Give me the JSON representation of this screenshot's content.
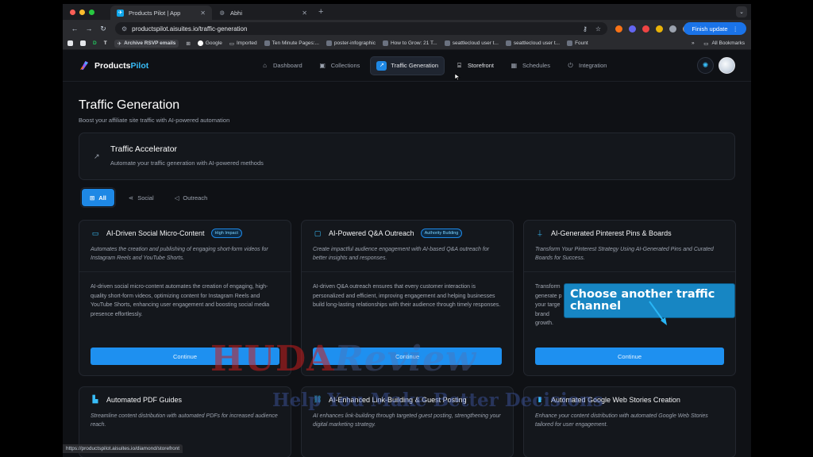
{
  "browser": {
    "tabs": [
      {
        "title": "Products Pilot | App",
        "active": true
      },
      {
        "title": "Abhi",
        "active": false
      }
    ],
    "url": "productspilot.aisuites.io/traffic-generation",
    "update_button": "Finish update",
    "bookmarks": [
      "Archive RSVP emails",
      "Google",
      "Imported",
      "Ten Minute Pages:...",
      "poster-infographic",
      "How to Grow: 21 T...",
      "seattlecloud user t...",
      "seattlecloud user t...",
      "Fount"
    ],
    "all_bookmarks": "All Bookmarks",
    "status_url": "https://productspilot.aisuites.io/diamond/storefront"
  },
  "app": {
    "logo_main": "Products",
    "logo_accent": "Pilot",
    "nav": [
      {
        "label": "Dashboard",
        "icon": "home-icon"
      },
      {
        "label": "Collections",
        "icon": "collections-icon"
      },
      {
        "label": "Traffic Generation",
        "icon": "trend-icon",
        "active": true
      },
      {
        "label": "Storefront",
        "icon": "store-icon"
      },
      {
        "label": "Schedules",
        "icon": "calendar-icon"
      },
      {
        "label": "Integration",
        "icon": "plug-icon"
      }
    ]
  },
  "page": {
    "title": "Traffic Generation",
    "subtitle": "Boost your affiliate site traffic with AI-powered automation",
    "accelerator": {
      "title": "Traffic Accelerator",
      "subtitle": "Automate your traffic generation with AI-powered methods"
    },
    "filters": [
      "All",
      "Social",
      "Outreach"
    ],
    "cards": [
      {
        "title": "AI-Driven Social Micro-Content",
        "badge": "High Impact",
        "icon": "video-icon",
        "desc": "Automates the creation and publishing of engaging short-form videos for Instagram Reels and YouTube Shorts.",
        "body": "AI-driven social micro-content automates the creation of engaging, high-quality short-form videos, optimizing content for Instagram Reels and YouTube Shorts, enhancing user engagement and boosting social media presence effortlessly.",
        "button": "Continue"
      },
      {
        "title": "AI-Powered Q&A Outreach",
        "badge": "Authority Building",
        "icon": "chat-icon",
        "desc": "Create impactful audience engagement with AI-based Q&A outreach for better insights and responses.",
        "body": "AI-driven Q&A outreach ensures that every customer interaction is personalized and efficient, improving engagement and helping businesses build long-lasting relationships with their audience through timely responses.",
        "button": "Continue"
      },
      {
        "title": "AI-Generated Pinterest Pins & Boards",
        "badge": "",
        "icon": "pin-icon",
        "desc": "Transform Your Pinterest Strategy Using AI-Generated Pins and Curated Boards for Success.",
        "body": "Transform generate p your targe brand growth.",
        "button": "Continue"
      },
      {
        "title": "Automated PDF Guides",
        "badge": "",
        "icon": "file-icon",
        "desc": "Streamline content distribution with automated PDFs for increased audience reach.",
        "body": "",
        "button": ""
      },
      {
        "title": "AI-Enhanced Link-Building & Guest Posting",
        "badge": "",
        "icon": "link-icon",
        "desc": "AI enhances link-building through targeted guest posting, strengthening your digital marketing strategy.",
        "body": "",
        "button": ""
      },
      {
        "title": "Automated Google Web Stories Creation",
        "badge": "",
        "icon": "stories-icon",
        "desc": "Enhance your content distribution with automated Google Web Stories tailored for user engagement.",
        "body": "",
        "button": ""
      }
    ]
  },
  "overlay": {
    "callout": "Choose another traffic channel",
    "watermark_main": "HUDA",
    "watermark_accent": "Review",
    "watermark_tagline": "Help You Make Better Decisions"
  },
  "colors": {
    "accent": "#1e88e5",
    "background": "#0f1115",
    "card": "#14171c"
  }
}
